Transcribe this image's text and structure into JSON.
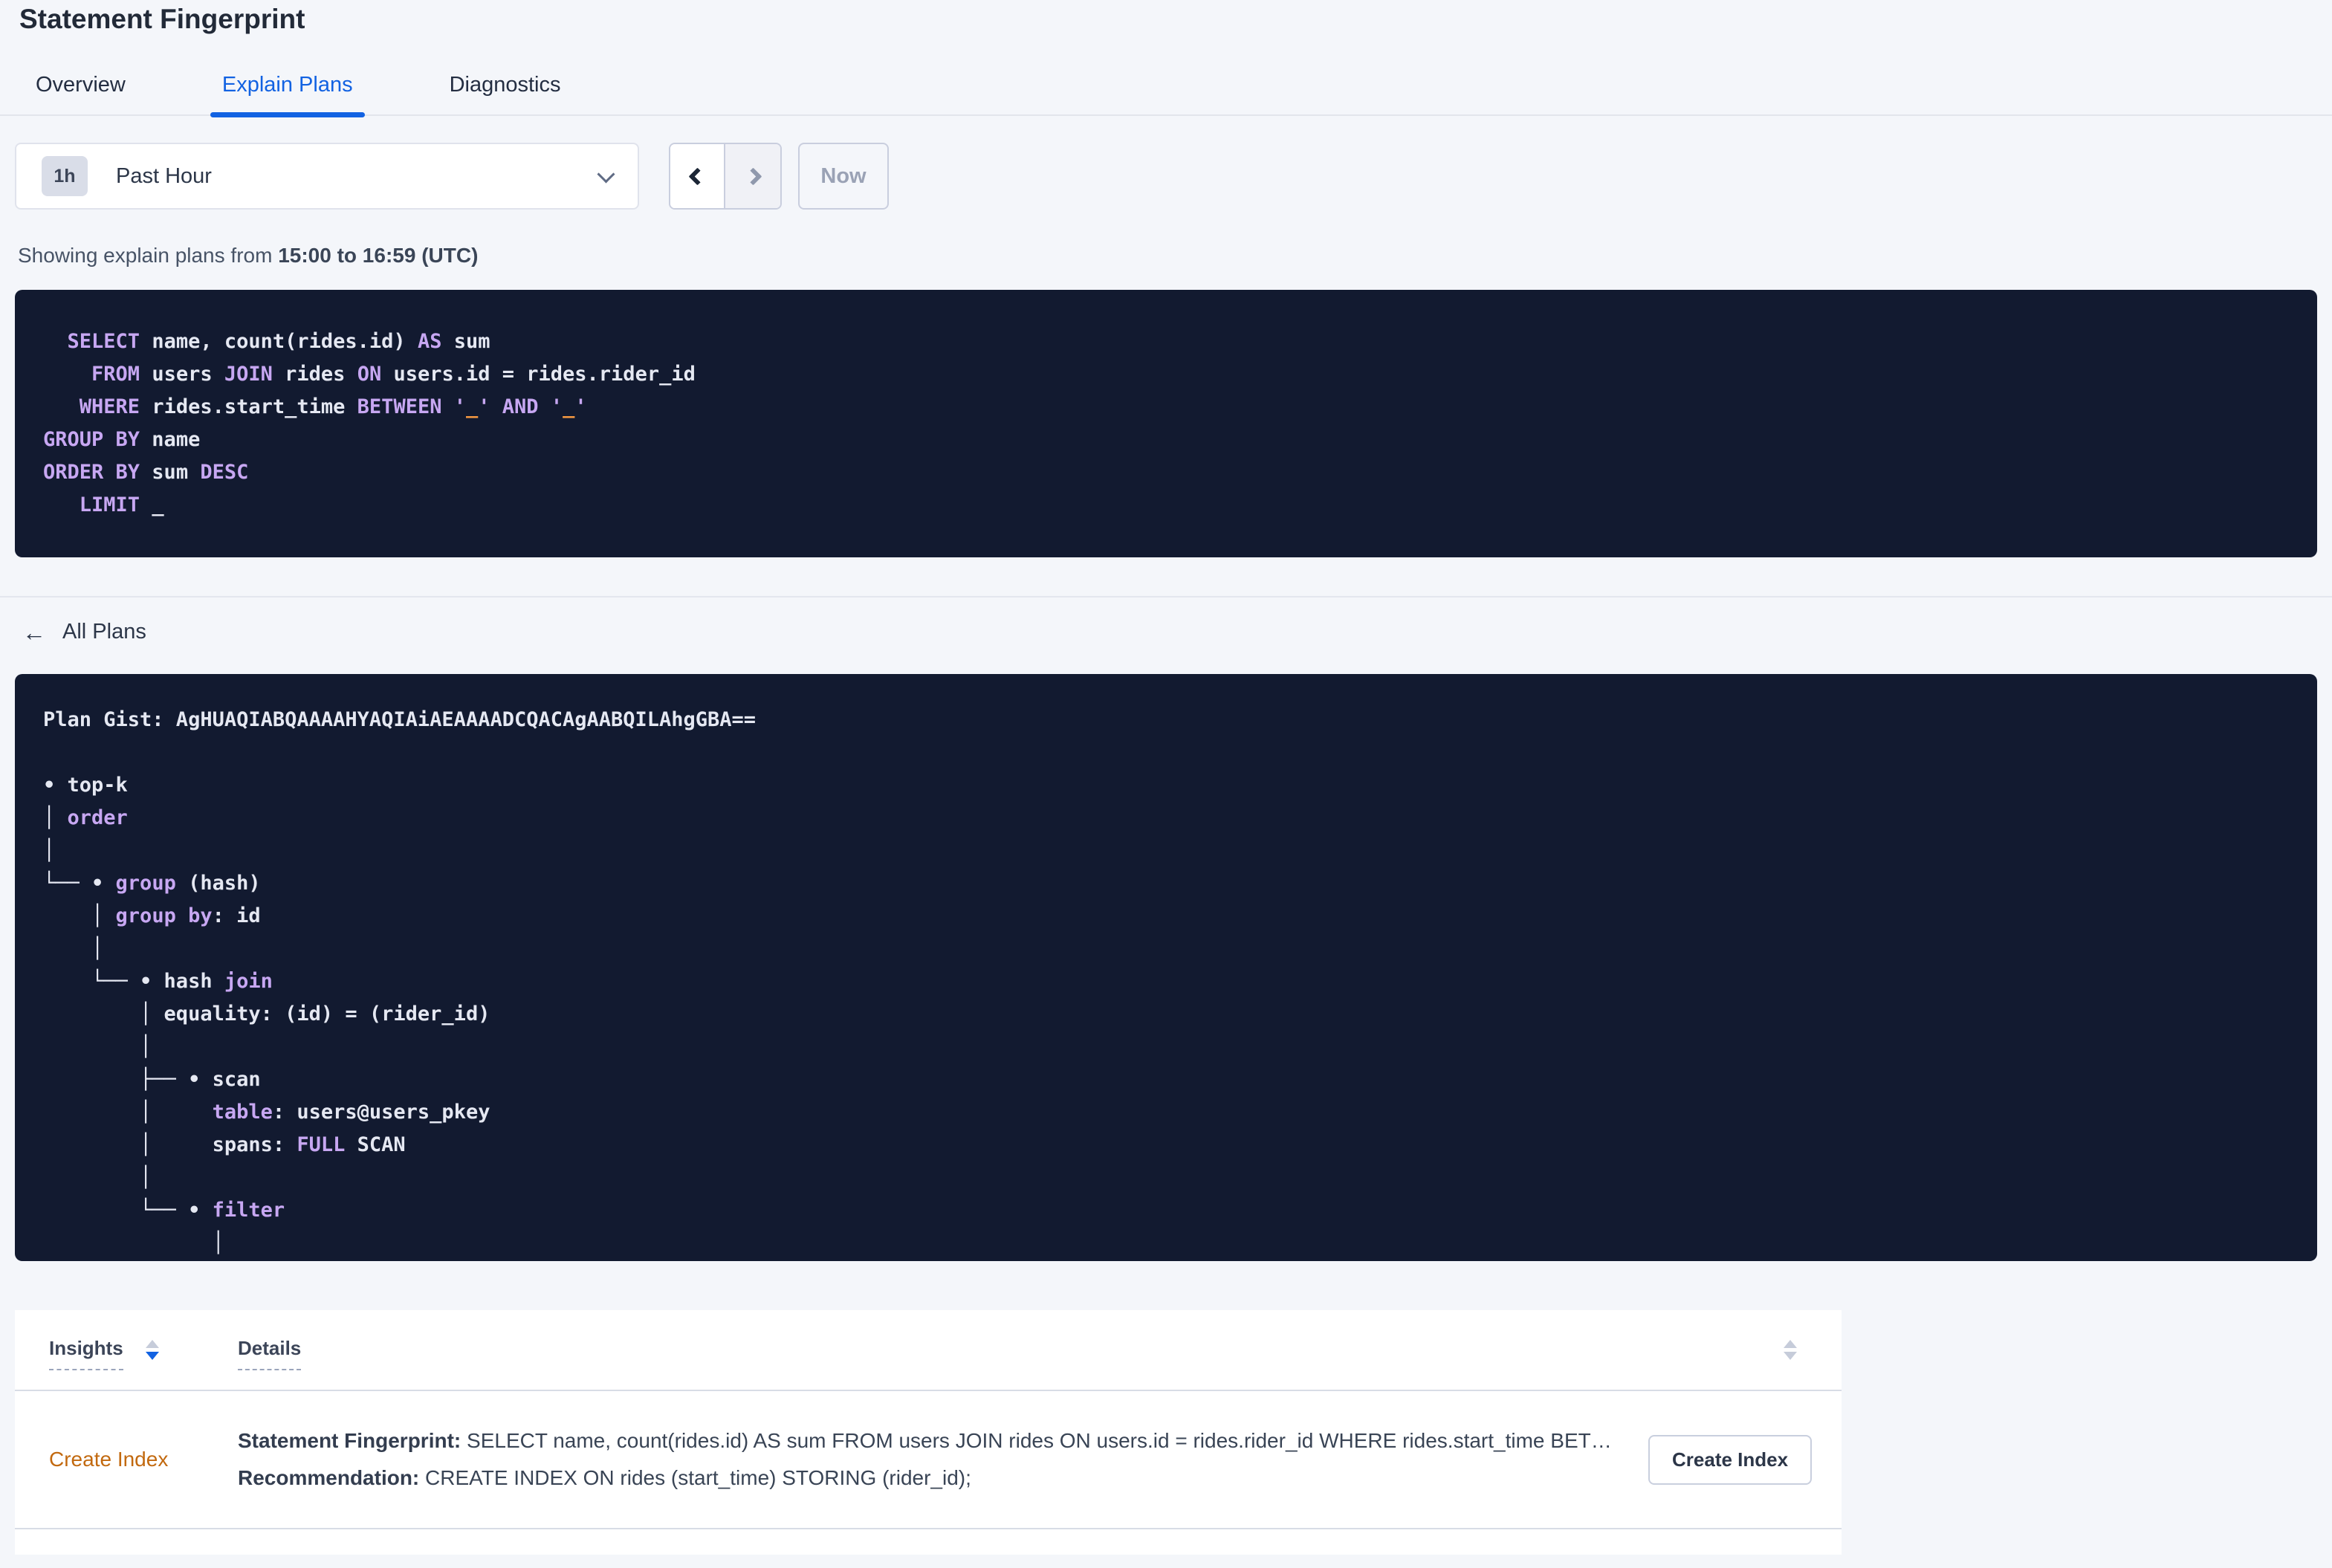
{
  "page": {
    "title": "Statement Fingerprint"
  },
  "tabs": [
    {
      "label": "Overview",
      "active": false
    },
    {
      "label": "Explain Plans",
      "active": true
    },
    {
      "label": "Diagnostics",
      "active": false
    }
  ],
  "time_picker": {
    "badge": "1h",
    "label": "Past Hour",
    "now_label": "Now"
  },
  "summary": {
    "prefix": "Showing explain plans from ",
    "range": "15:00 to 16:59 (UTC)"
  },
  "sql_block": {
    "lines": [
      [
        [
          "pl",
          "  "
        ],
        [
          "kw",
          "SELECT"
        ],
        [
          "pl",
          " name, count(rides.id) "
        ],
        [
          "kw",
          "AS"
        ],
        [
          "pl",
          " sum"
        ]
      ],
      [
        [
          "pl",
          "    "
        ],
        [
          "kw",
          "FROM"
        ],
        [
          "pl",
          " users "
        ],
        [
          "kw",
          "JOIN"
        ],
        [
          "pl",
          " rides "
        ],
        [
          "kw",
          "ON"
        ],
        [
          "pl",
          " users.id = rides.rider_id"
        ]
      ],
      [
        [
          "pl",
          "   "
        ],
        [
          "kw",
          "WHERE"
        ],
        [
          "pl",
          " rides.start_time "
        ],
        [
          "kw",
          "BETWEEN"
        ],
        [
          "pl",
          " "
        ],
        [
          "kw",
          "'"
        ],
        [
          "lit",
          "_"
        ],
        [
          "kw",
          "'"
        ],
        [
          "pl",
          " "
        ],
        [
          "kw",
          "AND"
        ],
        [
          "pl",
          " "
        ],
        [
          "kw",
          "'"
        ],
        [
          "lit",
          "_"
        ],
        [
          "kw",
          "'"
        ]
      ],
      [
        [
          "kw",
          "GROUP BY"
        ],
        [
          "pl",
          " name"
        ]
      ],
      [
        [
          "kw",
          "ORDER BY"
        ],
        [
          "pl",
          " sum "
        ],
        [
          "kw",
          "DESC"
        ]
      ],
      [
        [
          "pl",
          "   "
        ],
        [
          "kw",
          "LIMIT"
        ],
        [
          "pl",
          " _"
        ]
      ]
    ]
  },
  "all_plans": {
    "label": "All Plans",
    "arrow": "←"
  },
  "plan_block": {
    "lines": [
      [
        [
          "pl",
          "Plan Gist: AgHUAQIABQAAAAHYAQIAiAEAAAADCQACAgAABQILAhgGBA=="
        ]
      ],
      [
        [
          "pl",
          ""
        ]
      ],
      [
        [
          "pl",
          "• top-k"
        ]
      ],
      [
        [
          "pl",
          "│ "
        ],
        [
          "kw",
          "order"
        ]
      ],
      [
        [
          "pl",
          "│"
        ]
      ],
      [
        [
          "pl",
          "└── • "
        ],
        [
          "kw",
          "group"
        ],
        [
          "pl",
          " (hash)"
        ]
      ],
      [
        [
          "pl",
          "    │ "
        ],
        [
          "kw",
          "group by"
        ],
        [
          "pl",
          ": id"
        ]
      ],
      [
        [
          "pl",
          "    │"
        ]
      ],
      [
        [
          "pl",
          "    └── • hash "
        ],
        [
          "kw",
          "join"
        ]
      ],
      [
        [
          "pl",
          "        │ equality: (id) = (rider_id)"
        ]
      ],
      [
        [
          "pl",
          "        │"
        ]
      ],
      [
        [
          "pl",
          "        ├── • scan"
        ]
      ],
      [
        [
          "pl",
          "        │     "
        ],
        [
          "kw",
          "table"
        ],
        [
          "pl",
          ": users@users_pkey"
        ]
      ],
      [
        [
          "pl",
          "        │     spans: "
        ],
        [
          "kw",
          "FULL"
        ],
        [
          "pl",
          " SCAN"
        ]
      ],
      [
        [
          "pl",
          "        │"
        ]
      ],
      [
        [
          "pl",
          "        └── • "
        ],
        [
          "kw",
          "filter"
        ]
      ],
      [
        [
          "pl",
          "              │"
        ]
      ]
    ]
  },
  "insights_table": {
    "columns": [
      {
        "label": "Insights"
      },
      {
        "label": "Details"
      }
    ],
    "rows": [
      {
        "insight_type": "Create Index",
        "fingerprint_label": "Statement Fingerprint:",
        "fingerprint_text": " SELECT name, count(rides.id) AS sum FROM users JOIN rides ON users.id = rides.rider_id WHERE rides.start_time BETWEEN '_' AND '_' GROUP BY name ORDER BY sum DESC LIMIT _",
        "recommendation_label": "Recommendation:",
        "recommendation_text": " CREATE INDEX ON rides (start_time) STORING (rider_id);",
        "action_label": "Create Index"
      }
    ]
  },
  "colors": {
    "accent_blue": "#1262e2",
    "code_background": "#121a30",
    "code_keyword": "#c7a7f2",
    "code_plain": "#e5e8f2",
    "code_literal": "#f79a41",
    "insight_link_orange": "#c2690f",
    "page_background": "#f4f6fa"
  }
}
